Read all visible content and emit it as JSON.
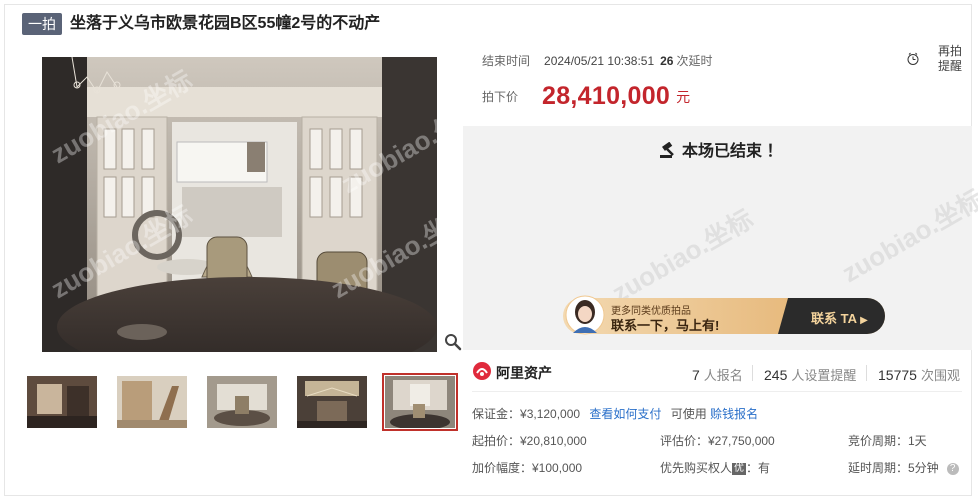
{
  "header": {
    "badge": "一拍",
    "title": "坐落于义乌市欧景花园B区55幢2号的不动产"
  },
  "auction": {
    "end_label": "结束时间",
    "end_time": "2024/05/21 10:38:51",
    "delay_count": "26",
    "delay_suffix": "次延时",
    "remind_line1": "再拍",
    "remind_line2": "提醒",
    "price_label": "拍下价",
    "price": "28,410,000",
    "price_unit": "元",
    "ended_text": "本场已结束 ！"
  },
  "banner": {
    "line1": "更多同类优质拍品",
    "line2": "联系一下，马上有!",
    "button": "联系 TA"
  },
  "platform": {
    "name": "阿里资产"
  },
  "stats": [
    {
      "num": "7",
      "unit": "人报名"
    },
    {
      "num": "245",
      "unit": "人设置提醒"
    },
    {
      "num": "15775",
      "unit": "次围观"
    }
  ],
  "details": {
    "deposit_label": "保证金：",
    "deposit": "¥3,120,000",
    "deposit_link1": "查看如何支付",
    "deposit_can": "可使用",
    "deposit_link2": "赊钱报名",
    "start_price": "起拍价：¥20,810,000",
    "appraisal": "评估价：¥27,750,000",
    "cycle": "竞价周期：1天",
    "increment": "加价幅度：¥100,000",
    "priority_prefix": "优先购买权人",
    "priority_tag": "优",
    "priority_suffix": "：有",
    "delay_cycle": "延时周期：5分钟"
  },
  "watermark": "zuobiao.坐标",
  "colors": {
    "accent": "#c3252c",
    "badge": "#5a6377",
    "link": "#2a6fc9",
    "banner_dark": "#2b2b2b",
    "banner_gold": "#e7b776"
  }
}
